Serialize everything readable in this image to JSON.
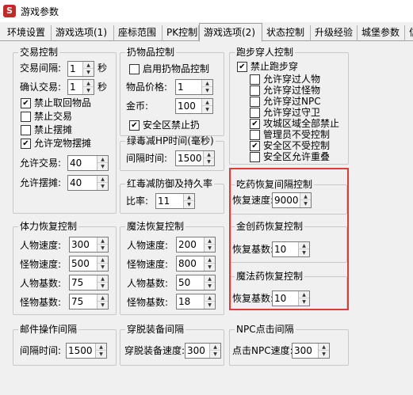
{
  "window": {
    "title": "游戏参数",
    "icon": "S"
  },
  "tabs": [
    "环境设置",
    "游戏选项(1)",
    "座标范围",
    "PK控制",
    "游戏选项(2)",
    "状态控制",
    "升级经验",
    "城堡参数",
    "信"
  ],
  "trade": {
    "title": "交易控制",
    "interval_label": "交易间隔:",
    "interval_value": "1",
    "interval_unit": "秒",
    "confirm_label": "确认交易:",
    "confirm_value": "1",
    "confirm_unit": "秒",
    "checks": [
      {
        "label": "禁止取回物品",
        "checked": true
      },
      {
        "label": "禁止交易",
        "checked": false
      },
      {
        "label": "禁止摆摊",
        "checked": false
      },
      {
        "label": "允许宠物摆摊",
        "checked": true
      }
    ],
    "allow_trade_label": "允许交易:",
    "allow_trade_value": "40",
    "allow_stall_label": "允许摆摊:",
    "allow_stall_value": "40"
  },
  "drop": {
    "title": "扔物品控制",
    "enable_label": "启用扔物品控制",
    "enable_checked": false,
    "price_label": "物品价格:",
    "price_value": "1",
    "gold_label": "金币:",
    "gold_value": "100",
    "safe_label": "安全区禁止扔",
    "safe_checked": true
  },
  "green_poison": {
    "title": "绿毒减HP时间(毫秒)",
    "label": "间隔时间:",
    "value": "1500"
  },
  "red_poison": {
    "title": "红毒减防御及持久率",
    "label": "比率:",
    "value": "11"
  },
  "walk": {
    "title": "跑步穿人控制",
    "main_label": "禁止跑步穿",
    "main_checked": true,
    "checks": [
      {
        "label": "允许穿过人物",
        "checked": false
      },
      {
        "label": "允许穿过怪物",
        "checked": false
      },
      {
        "label": "允许穿过NPC",
        "checked": false
      },
      {
        "label": "允许穿过守卫",
        "checked": false
      },
      {
        "label": "攻城区域全部禁止",
        "checked": true
      },
      {
        "label": "管理员不受控制",
        "checked": false
      },
      {
        "label": "安全区不受控制",
        "checked": true
      },
      {
        "label": "安全区允许重叠",
        "checked": false
      }
    ]
  },
  "pill": {
    "title": "吃药恢复间隔控制",
    "label": "恢复速度:",
    "value": "9000"
  },
  "gold_med": {
    "title": "金创药恢复控制",
    "label": "恢复基数:",
    "value": "10"
  },
  "magic_med": {
    "title": "魔法药恢复控制",
    "label": "恢复基数:",
    "value": "10"
  },
  "hp_recover": {
    "title": "体力恢复控制",
    "rows": [
      {
        "label": "人物速度:",
        "value": "300"
      },
      {
        "label": "怪物速度:",
        "value": "500"
      },
      {
        "label": "人物基数:",
        "value": "75"
      },
      {
        "label": "怪物基数:",
        "value": "75"
      }
    ]
  },
  "mp_recover": {
    "title": "魔法恢复控制",
    "rows": [
      {
        "label": "人物速度:",
        "value": "200"
      },
      {
        "label": "怪物速度:",
        "value": "800"
      },
      {
        "label": "人物基数:",
        "value": "50"
      },
      {
        "label": "怪物基数:",
        "value": "18"
      }
    ]
  },
  "mail": {
    "title": "邮件操作间隔",
    "label": "间隔时间:",
    "value": "1500"
  },
  "equip": {
    "title": "穿脱装备间隔",
    "label": "穿脱装备速度:",
    "value": "300"
  },
  "npc": {
    "title": "NPC点击间隔",
    "label": "点击NPC速度:",
    "value": "300"
  }
}
